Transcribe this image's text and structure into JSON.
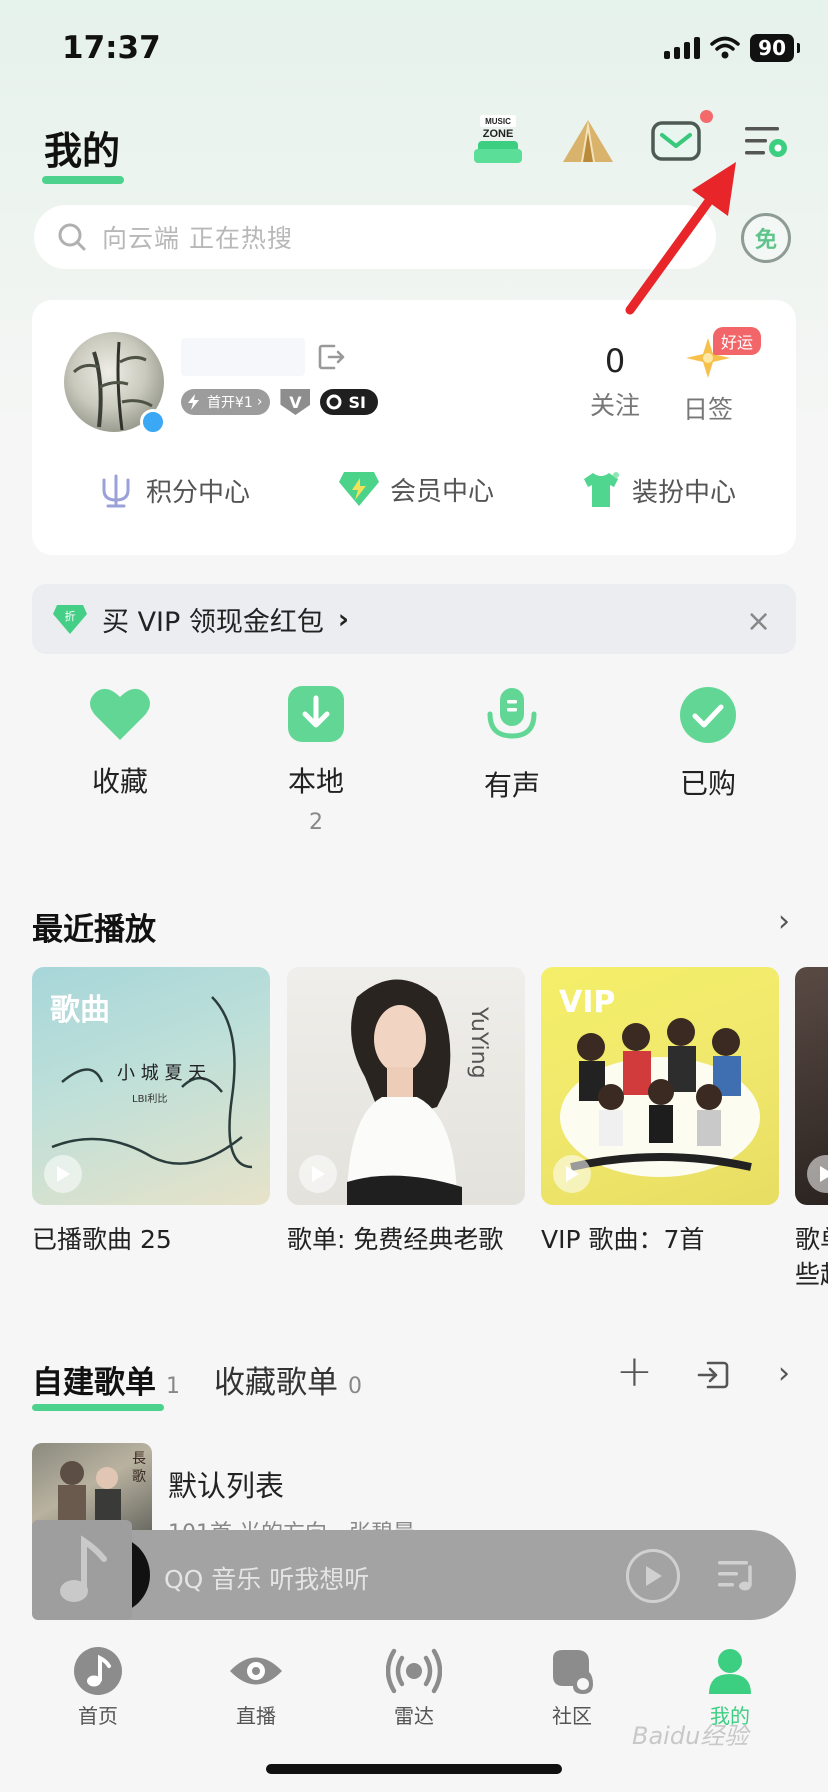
{
  "status_bar": {
    "time": "17:37",
    "battery": "90"
  },
  "header": {
    "title": "我的"
  },
  "search": {
    "placeholder": "向云端  正在热搜",
    "free_label": "免"
  },
  "profile": {
    "badge_first": "首开¥1",
    "badge_v": "V",
    "badge_si": "SI",
    "follow_count": "0",
    "follow_label": "关注",
    "checkin_label": "日签",
    "lucky_tag": "好运",
    "centers": [
      "积分中心",
      "会员中心",
      "装扮中心"
    ]
  },
  "vip_banner": {
    "icon_text": "折",
    "text": "买 VIP 领现金红包",
    "chevron": "›",
    "close": "×"
  },
  "quick_actions": [
    {
      "label": "收藏",
      "icon": "heart-icon"
    },
    {
      "label": "本地",
      "count": "2",
      "icon": "download-icon"
    },
    {
      "label": "有声",
      "icon": "microphone-icon"
    },
    {
      "label": "已购",
      "icon": "check-icon"
    }
  ],
  "recent": {
    "title": "最近播放",
    "chevron": "›",
    "items": [
      {
        "tag": "歌曲",
        "caption": "已播歌曲 25"
      },
      {
        "tag": "",
        "caption": "歌单: 免费经典老歌"
      },
      {
        "tag": "VIP",
        "caption": "VIP 歌曲：7首"
      },
      {
        "tag": "",
        "caption": "歌单",
        "caption2": "些起"
      }
    ]
  },
  "playlists": {
    "tab_created": "自建歌单",
    "tab_created_count": "1",
    "tab_collected": "收藏歌单",
    "tab_collected_count": "0",
    "add": "+",
    "chevron": "›",
    "items": [
      {
        "title": "默认列表",
        "subtitle": "101首 光的方向 - 张碧晨"
      }
    ]
  },
  "player": {
    "text": "QQ 音乐 听我想听"
  },
  "tabbar": {
    "items": [
      {
        "label": "首页",
        "icon": "music-note-icon"
      },
      {
        "label": "直播",
        "icon": "eye-icon"
      },
      {
        "label": "雷达",
        "icon": "radar-icon"
      },
      {
        "label": "社区",
        "icon": "community-icon"
      },
      {
        "label": "我的",
        "icon": "person-icon"
      }
    ]
  },
  "watermark": "Baidu经验",
  "colors": {
    "accent": "#4cd28c",
    "arrow": "#e8262a",
    "msg_dot": "#f26a6a"
  }
}
